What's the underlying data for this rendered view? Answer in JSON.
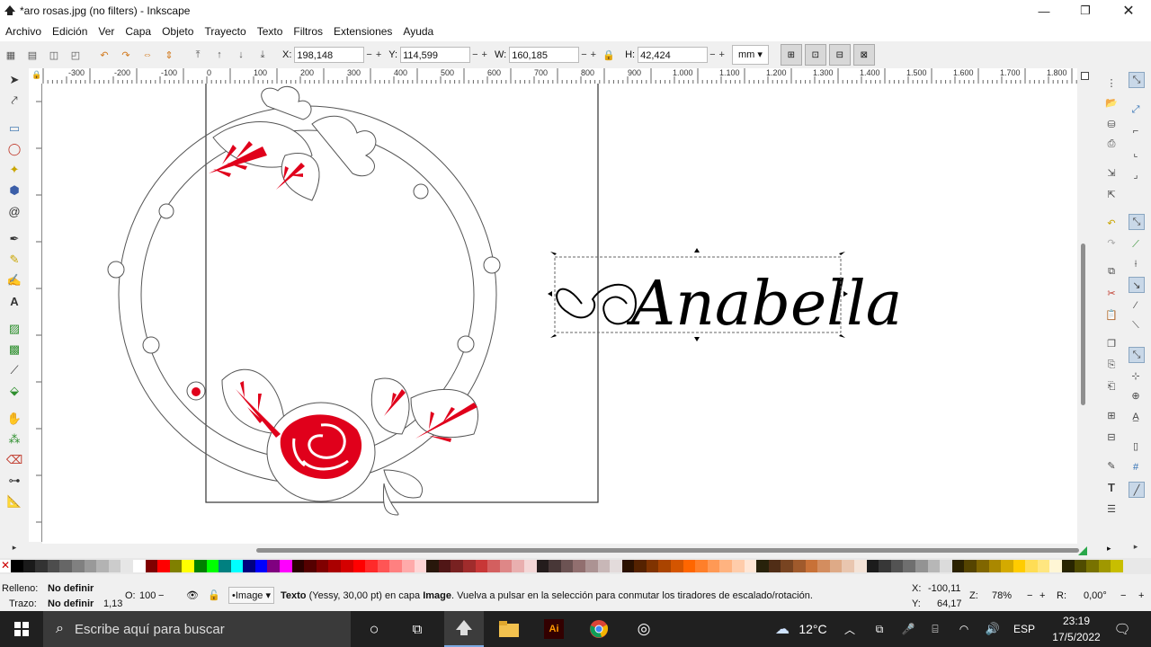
{
  "window": {
    "title": "*aro rosas.jpg (no filters) - Inkscape"
  },
  "menu": [
    "Archivo",
    "Edición",
    "Ver",
    "Capa",
    "Objeto",
    "Trayecto",
    "Texto",
    "Filtros",
    "Extensiones",
    "Ayuda"
  ],
  "controls": {
    "x_label": "X:",
    "x_value": "198,148",
    "y_label": "Y:",
    "y_value": "114,599",
    "w_label": "W:",
    "w_value": "160,185",
    "h_label": "H:",
    "h_value": "42,424",
    "unit": "mm"
  },
  "ruler_labels": [
    "-300",
    "-200",
    "-100",
    "0",
    "100",
    "200",
    "300",
    "400",
    "500",
    "600",
    "700",
    "800",
    "900",
    "1.000",
    "1.100",
    "1.200",
    "1.300",
    "1.400",
    "1.500",
    "1.600",
    "1.700",
    "1.800"
  ],
  "canvas": {
    "name_text": "Anabella"
  },
  "status": {
    "fill_label": "Relleno:",
    "fill_value": "No definir",
    "stroke_label": "Trazo:",
    "stroke_value": "No definir",
    "stroke_width": "1,13",
    "opacity_label": "O:",
    "opacity_value": "100",
    "layer": "•Image",
    "obj_type": "Texto",
    "message_mid": "(Yessy, 30,00 pt) en capa",
    "layer_bold": "Image",
    "message_end": ". Vuelva a pulsar en la selección para conmutar los tiradores de escalado/rotación.",
    "cursor_x_label": "X:",
    "cursor_x": "-100,11",
    "cursor_y_label": "Y:",
    "cursor_y": "64,17",
    "zoom_label": "Z:",
    "zoom": "78%",
    "rotation_label": "R:",
    "rotation": "0,00°"
  },
  "taskbar": {
    "search_placeholder": "Escribe aquí para buscar",
    "temperature": "12°C",
    "language": "ESP",
    "time": "23:19",
    "date": "17/5/2022"
  },
  "palette": [
    "#000000",
    "#1a1a1a",
    "#333333",
    "#4d4d4d",
    "#666666",
    "#808080",
    "#999999",
    "#b3b3b3",
    "#cccccc",
    "#e6e6e6",
    "#ffffff",
    "#800000",
    "#ff0000",
    "#808000",
    "#ffff00",
    "#008000",
    "#00ff00",
    "#008080",
    "#00ffff",
    "#000080",
    "#0000ff",
    "#800080",
    "#ff00ff",
    "#2b0000",
    "#550000",
    "#800000",
    "#aa0000",
    "#d40000",
    "#ff0000",
    "#ff2a2a",
    "#ff5555",
    "#ff8080",
    "#ffaaaa",
    "#ffd5d5",
    "#28170b",
    "#501616",
    "#782121",
    "#a02c2c",
    "#c83737",
    "#d35f5f",
    "#de8787",
    "#e9afaf",
    "#f4d7d7",
    "#241c1c",
    "#483737",
    "#6c5353",
    "#916f6f",
    "#ac9393",
    "#c8b7b7",
    "#e3dbdb",
    "#2b1100",
    "#552200",
    "#803300",
    "#aa4400",
    "#d45500",
    "#ff6600",
    "#ff7f2a",
    "#ff9955",
    "#ffb380",
    "#ffccaa",
    "#ffe6d5",
    "#28220b",
    "#502d16",
    "#784421",
    "#a05a2c",
    "#c87137",
    "#d38d5f",
    "#deaa87",
    "#e9c6af",
    "#f4e3d7",
    "#1c1c1c",
    "#373737",
    "#535353",
    "#6f6f6f",
    "#939393",
    "#b7b7b7",
    "#dbdbdb",
    "#2b2200",
    "#554400",
    "#806600",
    "#aa8800",
    "#d4aa00",
    "#ffcc00",
    "#ffdd55",
    "#ffe680",
    "#fff6d5",
    "#282500",
    "#504c00",
    "#787200",
    "#a09800",
    "#c8be00"
  ]
}
